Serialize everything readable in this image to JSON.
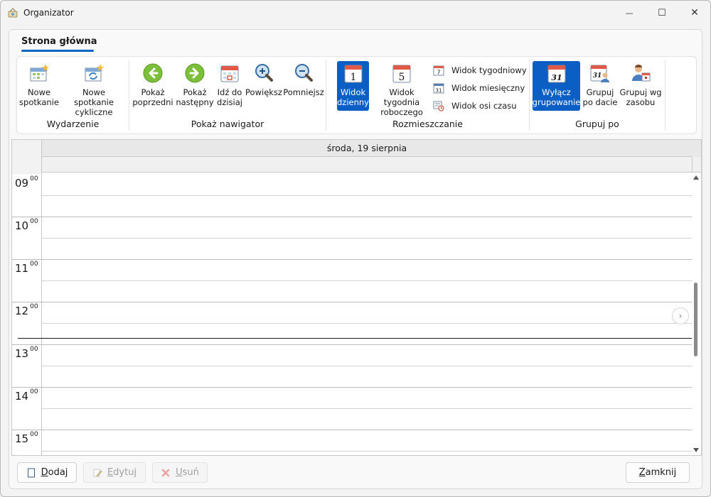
{
  "window": {
    "title": "Organizator",
    "minimize_glyph": "—",
    "maximize_glyph": "☐",
    "close_glyph": "✕"
  },
  "ribbon": {
    "tab": "Strona główna",
    "groups": [
      {
        "label": "Wydarzenie",
        "buttons": [
          {
            "line1": "Nowe",
            "line2": "spotkanie",
            "icon": "new-appointment-icon"
          },
          {
            "line1": "Nowe spotkanie",
            "line2": "cykliczne",
            "icon": "new-recurring-appointment-icon"
          }
        ]
      },
      {
        "label": "Pokaż nawigator",
        "buttons": [
          {
            "line1": "Pokaż",
            "line2": "poprzedni",
            "icon": "arrow-left-icon"
          },
          {
            "line1": "Pokaż",
            "line2": "następny",
            "icon": "arrow-right-icon"
          },
          {
            "line1": "Idź do",
            "line2": "dzisiaj",
            "icon": "today-calendar-icon"
          },
          {
            "line1": "Powiększ",
            "line2": "",
            "icon": "zoom-in-icon"
          },
          {
            "line1": "Pomniejsz",
            "line2": "",
            "icon": "zoom-out-icon"
          }
        ]
      },
      {
        "label": "Rozmieszczanie",
        "buttons": [
          {
            "line1": "Widok",
            "line2": "dzienny",
            "icon": "day-view-icon",
            "icon_text": "1",
            "active": true
          },
          {
            "line1": "Widok tygodnia",
            "line2": "roboczego",
            "icon": "work-week-view-icon",
            "icon_text": "5"
          }
        ],
        "small_buttons": [
          {
            "label": "Widok tygodniowy",
            "icon": "week-view-icon",
            "icon_text": "7"
          },
          {
            "label": "Widok miesięczny",
            "icon": "month-view-icon",
            "icon_text": "31"
          },
          {
            "label": "Widok osi czasu",
            "icon": "timeline-view-icon"
          }
        ]
      },
      {
        "label": "Grupuj po",
        "buttons": [
          {
            "line1": "Wyłącz",
            "line2": "grupowanie",
            "icon": "no-grouping-icon",
            "icon_text": "31",
            "active": true
          },
          {
            "line1": "Grupuj",
            "line2": "po dacie",
            "icon": "group-by-date-icon",
            "icon_text": "31"
          },
          {
            "line1": "Grupuj wg",
            "line2": "zasobu",
            "icon": "group-by-resource-icon"
          }
        ]
      }
    ]
  },
  "calendar": {
    "date_header": "środa, 19 sierpnia",
    "hours": [
      {
        "hour": "09",
        "minutes": "00"
      },
      {
        "hour": "10",
        "minutes": "00"
      },
      {
        "hour": "11",
        "minutes": "00"
      },
      {
        "hour": "12",
        "minutes": "00"
      },
      {
        "hour": "13",
        "minutes": "00"
      },
      {
        "hour": "14",
        "minutes": "00"
      },
      {
        "hour": "15",
        "minutes": "00"
      }
    ],
    "next_glyph": "›"
  },
  "footer": {
    "add": {
      "mnemonic": "D",
      "rest": "odaj"
    },
    "edit": {
      "mnemonic": "E",
      "rest": "dytuj"
    },
    "delete": {
      "mnemonic": "U",
      "rest": "suń"
    },
    "close": {
      "mnemonic": "Z",
      "rest": "amknij"
    }
  },
  "colors": {
    "accent": "#0067c0",
    "active_button": "#0b5fc4",
    "window_bg": "#f3f3f3"
  }
}
